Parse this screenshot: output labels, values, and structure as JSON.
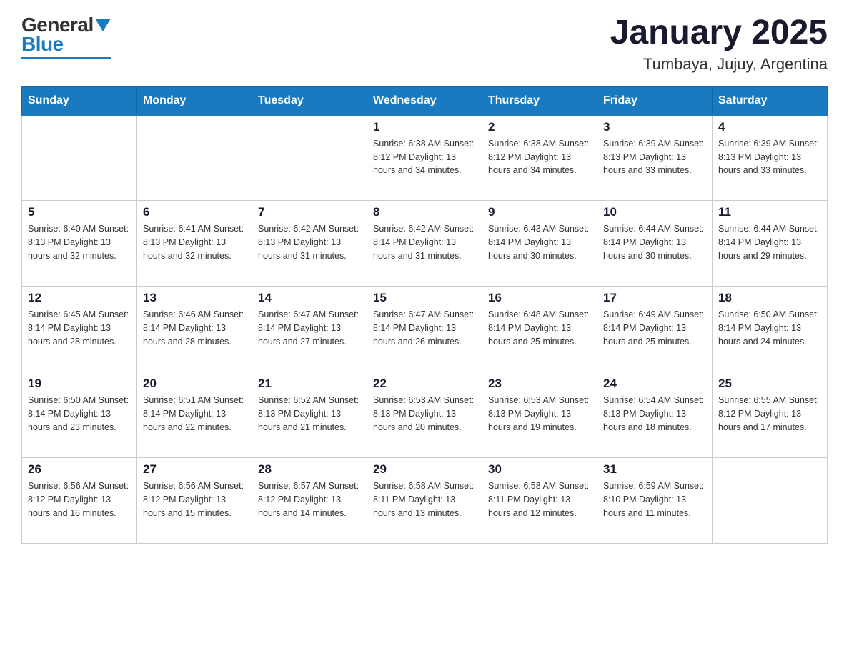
{
  "header": {
    "logo_general": "General",
    "logo_blue": "Blue",
    "month_title": "January 2025",
    "location": "Tumbaya, Jujuy, Argentina"
  },
  "days_of_week": [
    "Sunday",
    "Monday",
    "Tuesday",
    "Wednesday",
    "Thursday",
    "Friday",
    "Saturday"
  ],
  "weeks": [
    [
      {
        "day": "",
        "info": ""
      },
      {
        "day": "",
        "info": ""
      },
      {
        "day": "",
        "info": ""
      },
      {
        "day": "1",
        "info": "Sunrise: 6:38 AM\nSunset: 8:12 PM\nDaylight: 13 hours\nand 34 minutes."
      },
      {
        "day": "2",
        "info": "Sunrise: 6:38 AM\nSunset: 8:12 PM\nDaylight: 13 hours\nand 34 minutes."
      },
      {
        "day": "3",
        "info": "Sunrise: 6:39 AM\nSunset: 8:13 PM\nDaylight: 13 hours\nand 33 minutes."
      },
      {
        "day": "4",
        "info": "Sunrise: 6:39 AM\nSunset: 8:13 PM\nDaylight: 13 hours\nand 33 minutes."
      }
    ],
    [
      {
        "day": "5",
        "info": "Sunrise: 6:40 AM\nSunset: 8:13 PM\nDaylight: 13 hours\nand 32 minutes."
      },
      {
        "day": "6",
        "info": "Sunrise: 6:41 AM\nSunset: 8:13 PM\nDaylight: 13 hours\nand 32 minutes."
      },
      {
        "day": "7",
        "info": "Sunrise: 6:42 AM\nSunset: 8:13 PM\nDaylight: 13 hours\nand 31 minutes."
      },
      {
        "day": "8",
        "info": "Sunrise: 6:42 AM\nSunset: 8:14 PM\nDaylight: 13 hours\nand 31 minutes."
      },
      {
        "day": "9",
        "info": "Sunrise: 6:43 AM\nSunset: 8:14 PM\nDaylight: 13 hours\nand 30 minutes."
      },
      {
        "day": "10",
        "info": "Sunrise: 6:44 AM\nSunset: 8:14 PM\nDaylight: 13 hours\nand 30 minutes."
      },
      {
        "day": "11",
        "info": "Sunrise: 6:44 AM\nSunset: 8:14 PM\nDaylight: 13 hours\nand 29 minutes."
      }
    ],
    [
      {
        "day": "12",
        "info": "Sunrise: 6:45 AM\nSunset: 8:14 PM\nDaylight: 13 hours\nand 28 minutes."
      },
      {
        "day": "13",
        "info": "Sunrise: 6:46 AM\nSunset: 8:14 PM\nDaylight: 13 hours\nand 28 minutes."
      },
      {
        "day": "14",
        "info": "Sunrise: 6:47 AM\nSunset: 8:14 PM\nDaylight: 13 hours\nand 27 minutes."
      },
      {
        "day": "15",
        "info": "Sunrise: 6:47 AM\nSunset: 8:14 PM\nDaylight: 13 hours\nand 26 minutes."
      },
      {
        "day": "16",
        "info": "Sunrise: 6:48 AM\nSunset: 8:14 PM\nDaylight: 13 hours\nand 25 minutes."
      },
      {
        "day": "17",
        "info": "Sunrise: 6:49 AM\nSunset: 8:14 PM\nDaylight: 13 hours\nand 25 minutes."
      },
      {
        "day": "18",
        "info": "Sunrise: 6:50 AM\nSunset: 8:14 PM\nDaylight: 13 hours\nand 24 minutes."
      }
    ],
    [
      {
        "day": "19",
        "info": "Sunrise: 6:50 AM\nSunset: 8:14 PM\nDaylight: 13 hours\nand 23 minutes."
      },
      {
        "day": "20",
        "info": "Sunrise: 6:51 AM\nSunset: 8:14 PM\nDaylight: 13 hours\nand 22 minutes."
      },
      {
        "day": "21",
        "info": "Sunrise: 6:52 AM\nSunset: 8:13 PM\nDaylight: 13 hours\nand 21 minutes."
      },
      {
        "day": "22",
        "info": "Sunrise: 6:53 AM\nSunset: 8:13 PM\nDaylight: 13 hours\nand 20 minutes."
      },
      {
        "day": "23",
        "info": "Sunrise: 6:53 AM\nSunset: 8:13 PM\nDaylight: 13 hours\nand 19 minutes."
      },
      {
        "day": "24",
        "info": "Sunrise: 6:54 AM\nSunset: 8:13 PM\nDaylight: 13 hours\nand 18 minutes."
      },
      {
        "day": "25",
        "info": "Sunrise: 6:55 AM\nSunset: 8:12 PM\nDaylight: 13 hours\nand 17 minutes."
      }
    ],
    [
      {
        "day": "26",
        "info": "Sunrise: 6:56 AM\nSunset: 8:12 PM\nDaylight: 13 hours\nand 16 minutes."
      },
      {
        "day": "27",
        "info": "Sunrise: 6:56 AM\nSunset: 8:12 PM\nDaylight: 13 hours\nand 15 minutes."
      },
      {
        "day": "28",
        "info": "Sunrise: 6:57 AM\nSunset: 8:12 PM\nDaylight: 13 hours\nand 14 minutes."
      },
      {
        "day": "29",
        "info": "Sunrise: 6:58 AM\nSunset: 8:11 PM\nDaylight: 13 hours\nand 13 minutes."
      },
      {
        "day": "30",
        "info": "Sunrise: 6:58 AM\nSunset: 8:11 PM\nDaylight: 13 hours\nand 12 minutes."
      },
      {
        "day": "31",
        "info": "Sunrise: 6:59 AM\nSunset: 8:10 PM\nDaylight: 13 hours\nand 11 minutes."
      },
      {
        "day": "",
        "info": ""
      }
    ]
  ]
}
